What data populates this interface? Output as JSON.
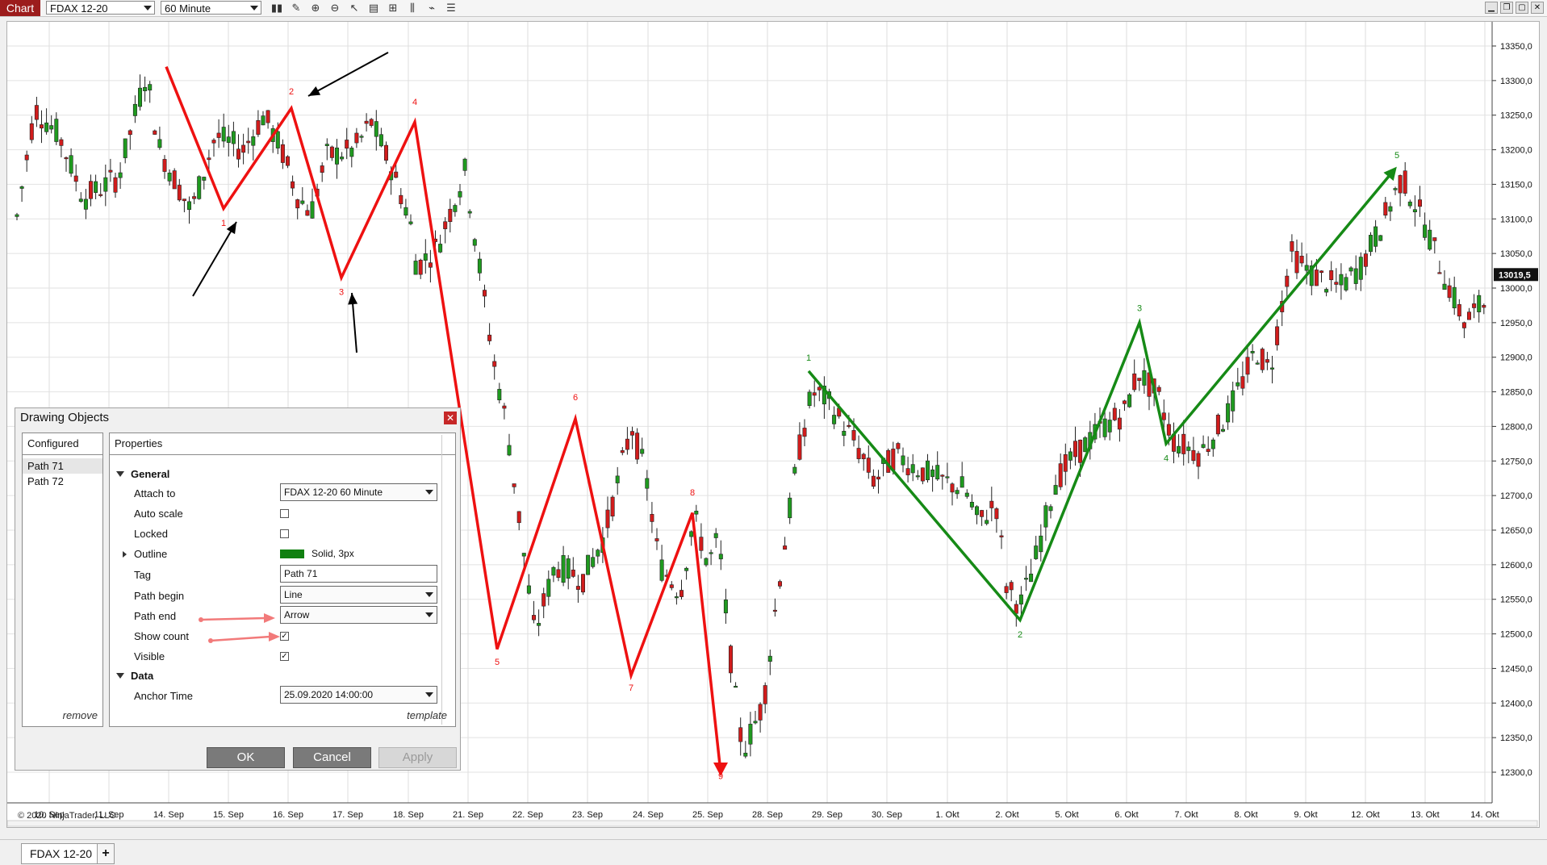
{
  "toolbar": {
    "chart_tab": "Chart",
    "instrument": "FDAX 12-20",
    "interval": "60 Minute",
    "icons": [
      "bar-type-icon",
      "pencil-icon",
      "zoom-in-icon",
      "zoom-out-icon",
      "pointer-icon",
      "properties-icon",
      "strategies-icon",
      "indicators-icon",
      "templates-icon",
      "list-icon"
    ],
    "window_buttons": [
      "minimize-icon",
      "restore-icon",
      "maximize-icon",
      "close-icon"
    ]
  },
  "chart": {
    "copyright": "© 2020 NinjaTrader, LLC",
    "last_price_label": "13019,5",
    "price_labels": [
      "13350,0",
      "13300,0",
      "13250,0",
      "13200,0",
      "13150,0",
      "13100,0",
      "13050,0",
      "13000,0",
      "12950,0",
      "12900,0",
      "12850,0",
      "12800,0",
      "12750,0",
      "12700,0",
      "12650,0",
      "12600,0",
      "12550,0",
      "12500,0",
      "12450,0",
      "12400,0",
      "12350,0",
      "12300,0"
    ],
    "date_labels": [
      "10. Sep",
      "11. Sep",
      "14. Sep",
      "15. Sep",
      "16. Sep",
      "17. Sep",
      "18. Sep",
      "21. Sep",
      "22. Sep",
      "23. Sep",
      "24. Sep",
      "25. Sep",
      "28. Sep",
      "29. Sep",
      "30. Sep",
      "1. Okt",
      "2. Okt",
      "5. Okt",
      "6. Okt",
      "7. Okt",
      "8. Okt",
      "9. Okt",
      "12. Okt",
      "13. Okt",
      "14. Okt"
    ],
    "colors": {
      "up": "#1f9a1f",
      "down": "#d11c1c",
      "red_path": "#ee1111",
      "green_path": "#168a16"
    },
    "red_path_labels": [
      "1",
      "2",
      "3",
      "4",
      "5",
      "6",
      "7",
      "8",
      "9"
    ],
    "green_path_labels": [
      "1",
      "2",
      "3",
      "4",
      "5"
    ]
  },
  "dialog": {
    "title": "Drawing Objects",
    "configured_header": "Configured",
    "configured_items": [
      "Path 71",
      "Path 72"
    ],
    "remove": "remove",
    "properties_header": "Properties",
    "section_general": "General",
    "section_data": "Data",
    "attach_to_label": "Attach to",
    "attach_to_value": "FDAX 12-20 60 Minute",
    "auto_scale_label": "Auto scale",
    "locked_label": "Locked",
    "outline_label": "Outline",
    "outline_value": "Solid, 3px",
    "tag_label": "Tag",
    "tag_value": "Path 71",
    "path_begin_label": "Path begin",
    "path_begin_value": "Line",
    "path_end_label": "Path end",
    "path_end_value": "Arrow",
    "show_count_label": "Show count",
    "visible_label": "Visible",
    "anchor_time_label": "Anchor Time",
    "anchor_time_value": "25.09.2020 14:00:00",
    "template": "template",
    "ok": "OK",
    "cancel": "Cancel",
    "apply": "Apply"
  },
  "bottom": {
    "instrument_tab": "FDAX 12-20",
    "add_tab": "+"
  }
}
